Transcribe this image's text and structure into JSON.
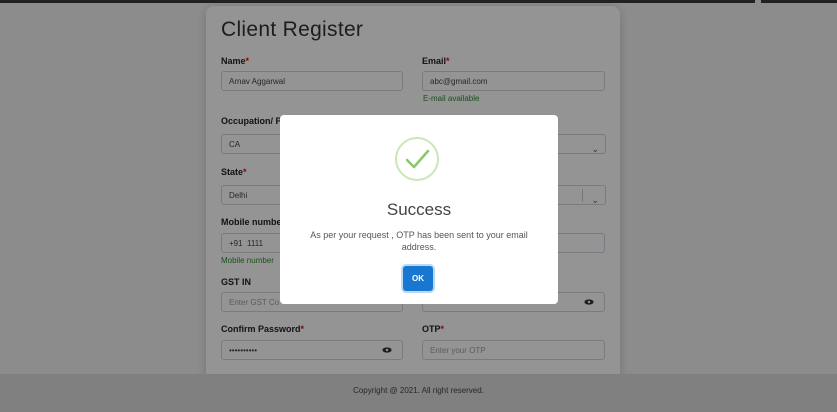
{
  "form": {
    "title": "Client Register",
    "name": {
      "label": "Name",
      "required": "*",
      "value": "Arnav Aggarwal"
    },
    "email": {
      "label": "Email",
      "required": "*",
      "value": "abc@gmail.com",
      "hint": "E-mail available"
    },
    "occupation": {
      "label": "Occupation/ P",
      "value": "CA"
    },
    "state": {
      "label": "State",
      "required": "*",
      "value": "Delhi"
    },
    "mobile": {
      "label": "Mobile number",
      "code": "+91",
      "value": "1111",
      "hint": "Mobile number"
    },
    "gst": {
      "label": "GST IN",
      "placeholder": "Enter GST Co"
    },
    "password": {
      "value": ""
    },
    "confirm_password": {
      "label": "Confirm Password",
      "required": "*",
      "value": "••••••••••"
    },
    "otp": {
      "label": "OTP",
      "required": "*",
      "placeholder": "Enter your OTP"
    }
  },
  "footer": {
    "text": "Copyright @ 2021. All right reserved."
  },
  "modal": {
    "title": "Success",
    "message": "As per your request , OTP has been sent to your email address.",
    "ok_label": "OK"
  },
  "icons": {
    "check": "check-icon",
    "eye": "eye-icon",
    "chevron": "chevron-down-icon"
  },
  "colors": {
    "primary": "#1878d1",
    "success": "#2e8b2e",
    "check": "#8cc96a",
    "required": "#dd1111"
  }
}
